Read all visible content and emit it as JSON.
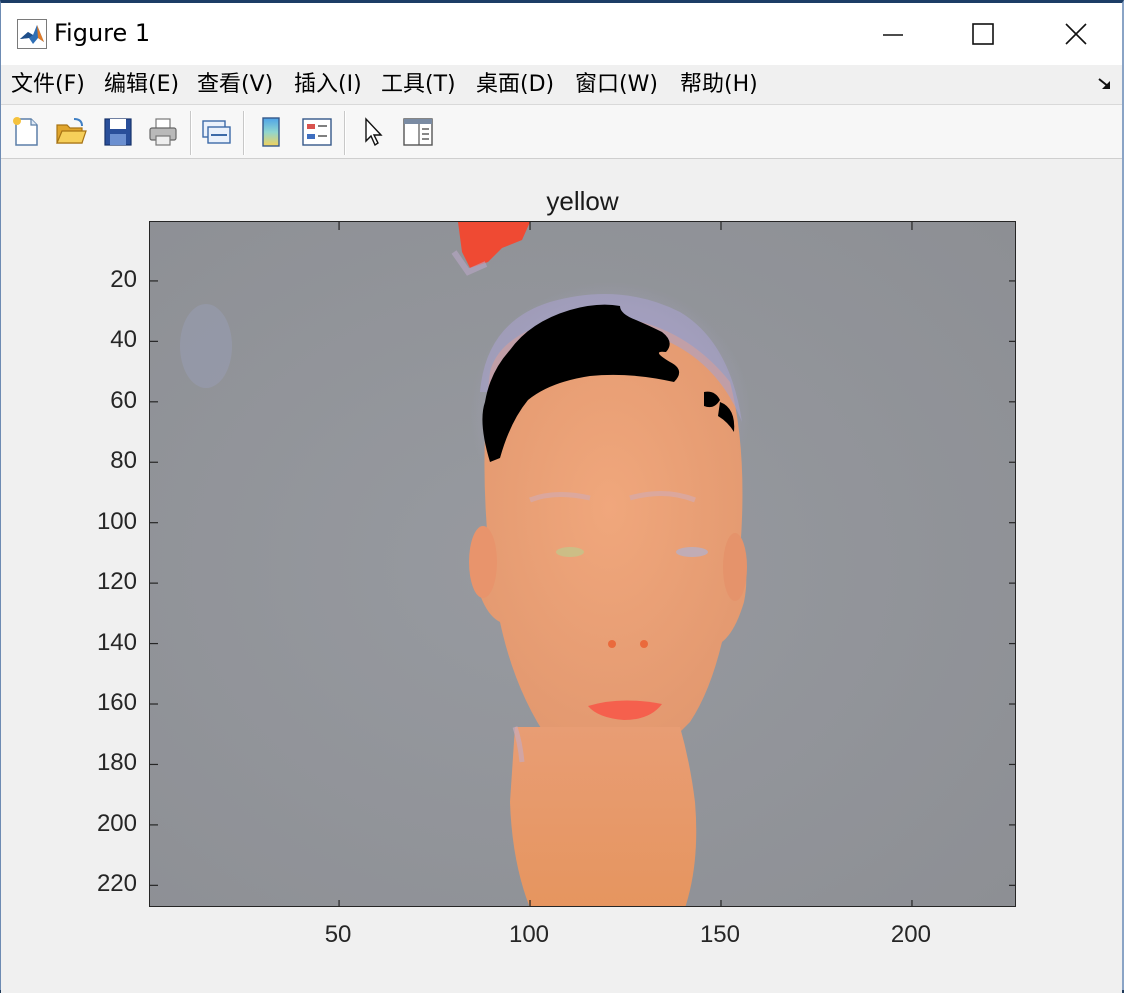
{
  "window": {
    "title": "Figure 1"
  },
  "menubar": {
    "items": [
      {
        "label": "文件(F)"
      },
      {
        "label": "编辑(E)"
      },
      {
        "label": "查看(V)"
      },
      {
        "label": "插入(I)"
      },
      {
        "label": "工具(T)"
      },
      {
        "label": "桌面(D)"
      },
      {
        "label": "窗口(W)"
      },
      {
        "label": "帮助(H)"
      }
    ]
  },
  "toolbar": {
    "tools": [
      "new-figure-icon",
      "open-file-icon",
      "save-icon",
      "print-icon",
      "link-plot-icon",
      "colorbar-icon",
      "legend-icon",
      "pointer-icon",
      "property-inspector-icon"
    ]
  },
  "axes": {
    "title": "yellow",
    "x_ticks": [
      "50",
      "100",
      "150",
      "200"
    ],
    "y_ticks": [
      "20",
      "40",
      "60",
      "80",
      "100",
      "120",
      "140",
      "160",
      "180",
      "200",
      "220"
    ],
    "xlim": [
      0.5,
      227.5
    ],
    "ylim": [
      0.5,
      227.5
    ],
    "image_description_colors": {
      "background": "#8f9196",
      "skin": "#e39a72",
      "hair": "#000000",
      "lips": "#f5604d",
      "red_blob": "#f0452e"
    }
  }
}
